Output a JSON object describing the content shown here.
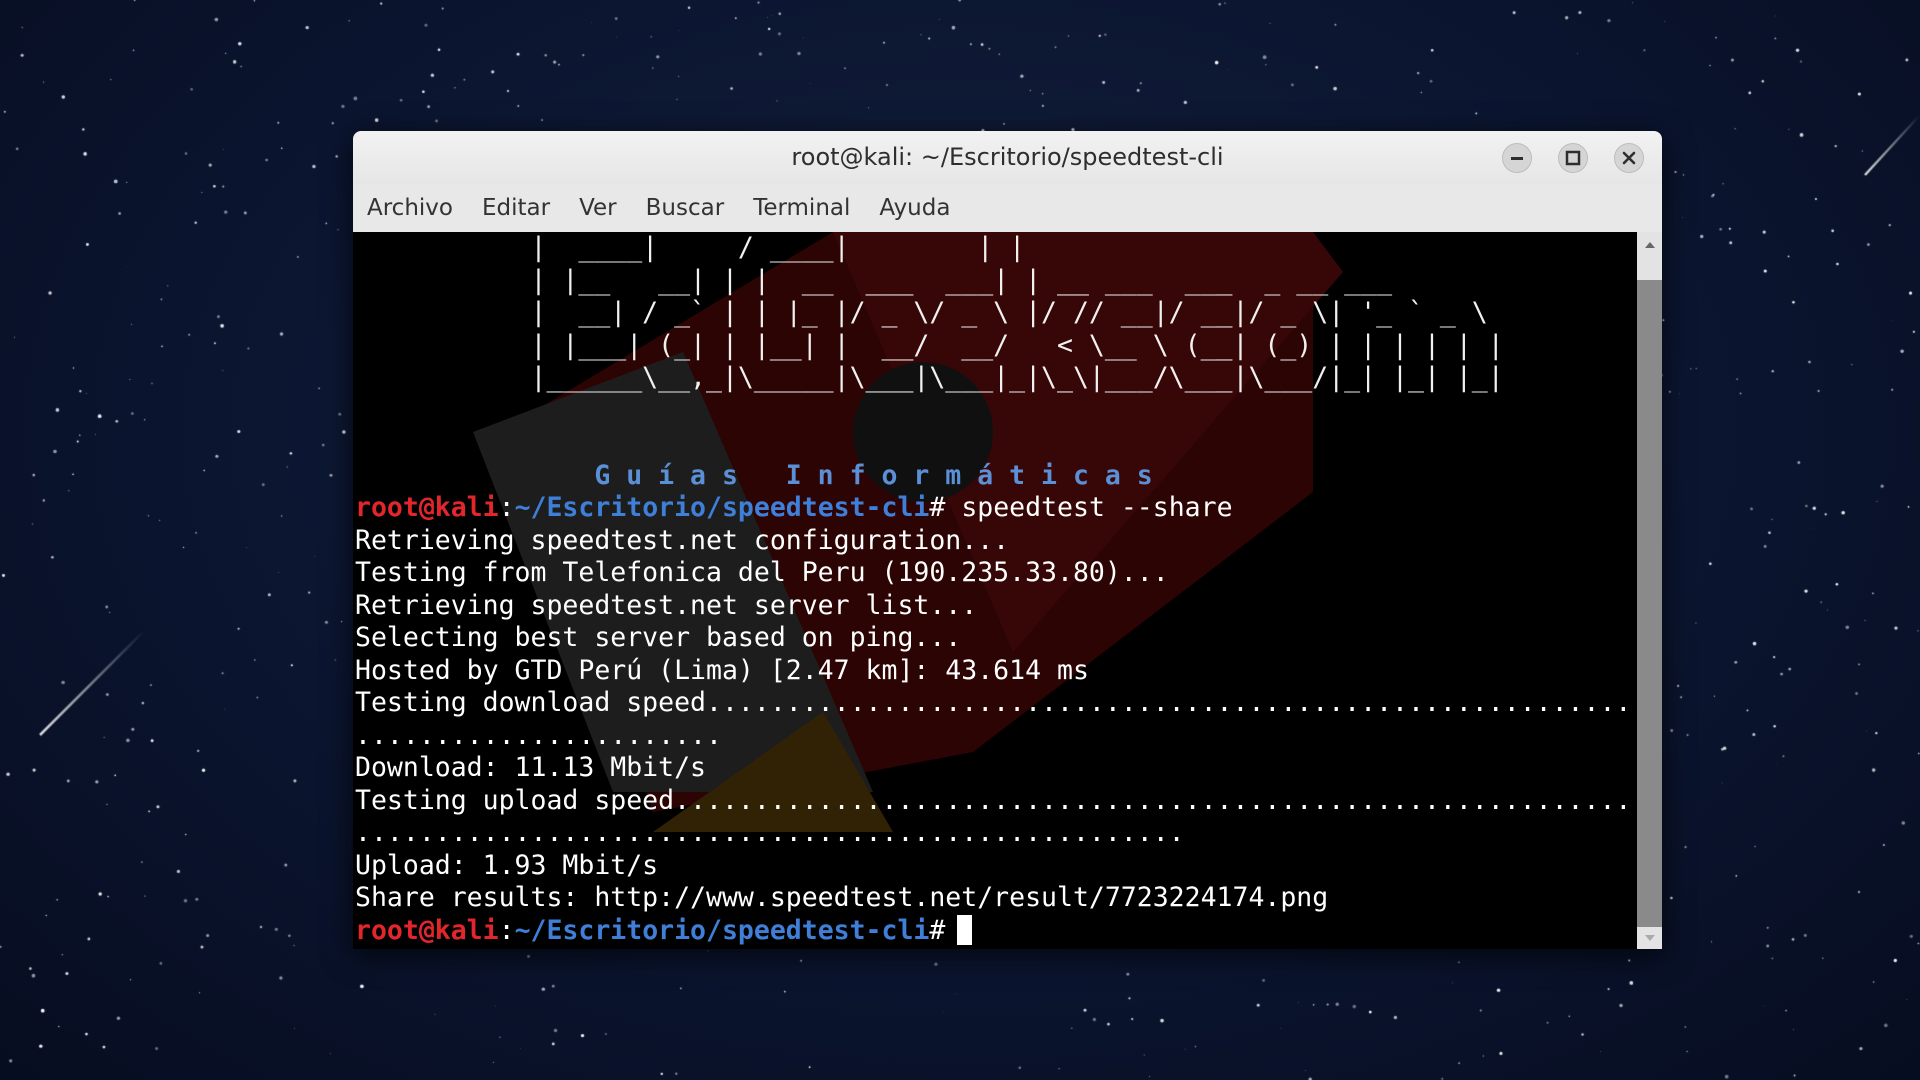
{
  "window": {
    "title": "root@kali: ~/Escritorio/speedtest-cli",
    "controls": [
      "minimize-icon",
      "maximize-icon",
      "close-icon"
    ]
  },
  "menu": [
    "Archivo",
    "Editar",
    "Ver",
    "Buscar",
    "Terminal",
    "Ayuda"
  ],
  "banner": {
    "ascii": [
      "           |  ____|     / ____|        | |",
      "           | |__   __| | |  __  ___  ___| | __ ___  ___  _ __ ___",
      "           |  __| / _` | | |_ |/ _ \\/ _ \\ |/ // __|/ __|/ _ \\| '_ ` _ \\",
      "           | |___| (_| | |__| |  __/  __/   < \\__ \\ (__| (_) | | | | | |",
      "           |______\\__,_|\\_____|\\___|\\___|_|\\_\\|___/\\___|\\___/|_| |_| |_|"
    ],
    "tagline": "               G u í a s   I n f o r m á t i c a s"
  },
  "prompt": {
    "user": "root@kali",
    "path": "~/Escritorio/speedtest-cli",
    "symbol": "#"
  },
  "command": " speedtest --share",
  "output": [
    "Retrieving speedtest.net configuration...",
    "Testing from Telefonica del Peru (190.235.33.80)...",
    "Retrieving speedtest.net server list...",
    "Selecting best server based on ping...",
    "Hosted by GTD Perú (Lima) [2.47 km]: 43.614 ms",
    "Testing download speed................................................................................",
    ".......................",
    "Download: 11.13 Mbit/s",
    "Testing upload speed..................................................................................",
    "....................................................",
    "Upload: 1.93 Mbit/s",
    "Share results: http://www.speedtest.net/result/7723224174.png"
  ],
  "colors": {
    "user": "#e2262b",
    "path": "#3f7fd8",
    "tagline": "#5b8fd6"
  }
}
